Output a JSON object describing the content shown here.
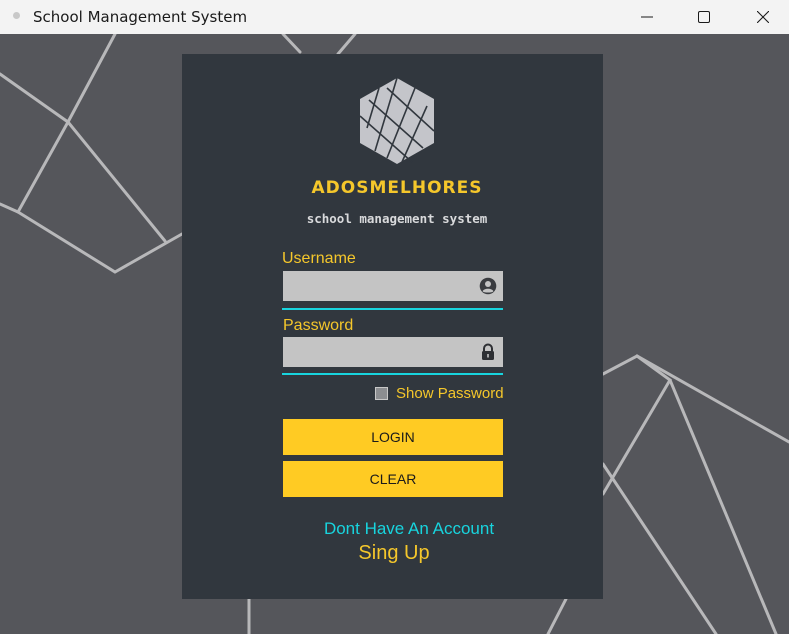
{
  "window": {
    "title": "School Management System"
  },
  "brand": {
    "name": "ADOSMELHORES",
    "tagline": "school management system"
  },
  "form": {
    "username_label": "Username",
    "username_value": "",
    "password_label": "Password",
    "password_value": "",
    "show_password_label": "Show Password",
    "show_password_checked": false,
    "login_label": "LOGIN",
    "clear_label": "CLEAR"
  },
  "footer": {
    "no_account_text": "Dont Have An Account",
    "signup_label": "Sing Up"
  },
  "icons": {
    "user_field": "user-circle-icon",
    "password_field": "lock-icon",
    "logo": "hexagon-logo-icon"
  },
  "colors": {
    "accent_yellow": "#ffcb23",
    "accent_cyan": "#18d4de",
    "panel": "#31373e",
    "background": "#55565b"
  }
}
